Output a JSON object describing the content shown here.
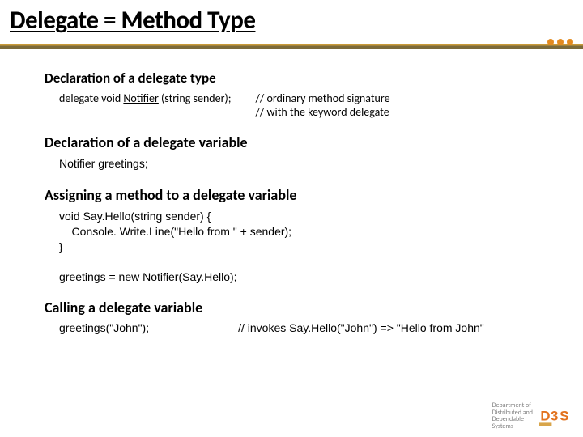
{
  "title": "Delegate = Method Type",
  "s1": {
    "heading": "Declaration of a delegate type",
    "code_pre": "delegate void ",
    "code_ul": "Notifier",
    "code_post": " (string sender);",
    "comment_l1": "// ordinary method signature",
    "comment_l2_pre": "// with the keyword ",
    "comment_l2_ul": "delegate"
  },
  "s2": {
    "heading": "Declaration of a delegate variable",
    "code": "Notifier greetings;"
  },
  "s3": {
    "heading": "Assigning a method to a delegate variable",
    "code": "void Say.Hello(string sender) {\n    Console. Write.Line(\"Hello from \" + sender);\n}",
    "assign": "greetings = new Notifier(Say.Hello);"
  },
  "s4": {
    "heading": "Calling a delegate variable",
    "call": "greetings(\"John\");",
    "comment": "// invokes Say.Hello(\"John\") => \"Hello from John\""
  },
  "footer": {
    "dept_l1": "Department of",
    "dept_l2": "Distributed and",
    "dept_l3": "Dependable",
    "dept_l4": "Systems"
  }
}
